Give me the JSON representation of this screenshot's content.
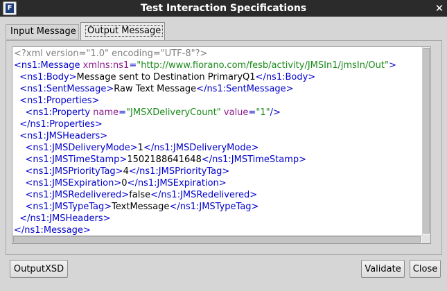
{
  "window": {
    "title": "Test Interaction Specifications",
    "app_icon_glyph": "F",
    "close_glyph": "✕"
  },
  "tabs": [
    {
      "label": "Input Message",
      "active": false
    },
    {
      "label": "Output Message",
      "active": true
    }
  ],
  "editor": {
    "lines": [
      [
        {
          "t": "decl",
          "v": "<?xml version=\"1.0\" encoding=\"UTF-8\"?>"
        }
      ],
      [
        {
          "t": "tag",
          "v": "<ns1:Message "
        },
        {
          "t": "attr",
          "v": "xmlns:ns1"
        },
        {
          "t": "tag",
          "v": "="
        },
        {
          "t": "val",
          "v": "\"http://www.fiorano.com/fesb/activity/JMSIn1/jmsIn/Out\""
        },
        {
          "t": "tag",
          "v": ">"
        }
      ],
      [
        {
          "t": "tag",
          "v": "  <ns1:Body>"
        },
        {
          "t": "text",
          "v": "Message sent to Destination PrimaryQ1"
        },
        {
          "t": "tag",
          "v": "</ns1:Body>"
        }
      ],
      [
        {
          "t": "tag",
          "v": "  <ns1:SentMessage>"
        },
        {
          "t": "text",
          "v": "Raw Text Message"
        },
        {
          "t": "tag",
          "v": "</ns1:SentMessage>"
        }
      ],
      [
        {
          "t": "tag",
          "v": "  <ns1:Properties>"
        }
      ],
      [
        {
          "t": "tag",
          "v": "    <ns1:Property "
        },
        {
          "t": "attr",
          "v": "name"
        },
        {
          "t": "tag",
          "v": "="
        },
        {
          "t": "val",
          "v": "\"JMSXDeliveryCount\""
        },
        {
          "t": "tag",
          "v": " "
        },
        {
          "t": "attr",
          "v": "value"
        },
        {
          "t": "tag",
          "v": "="
        },
        {
          "t": "val",
          "v": "\"1\""
        },
        {
          "t": "tag",
          "v": "/>"
        }
      ],
      [
        {
          "t": "tag",
          "v": "  </ns1:Properties>"
        }
      ],
      [
        {
          "t": "tag",
          "v": "  <ns1:JMSHeaders>"
        }
      ],
      [
        {
          "t": "tag",
          "v": "    <ns1:JMSDeliveryMode>"
        },
        {
          "t": "text",
          "v": "1"
        },
        {
          "t": "tag",
          "v": "</ns1:JMSDeliveryMode>"
        }
      ],
      [
        {
          "t": "tag",
          "v": "    <ns1:JMSTimeStamp>"
        },
        {
          "t": "text",
          "v": "1502188641648"
        },
        {
          "t": "tag",
          "v": "</ns1:JMSTimeStamp>"
        }
      ],
      [
        {
          "t": "tag",
          "v": "    <ns1:JMSPriorityTag>"
        },
        {
          "t": "text",
          "v": "4"
        },
        {
          "t": "tag",
          "v": "</ns1:JMSPriorityTag>"
        }
      ],
      [
        {
          "t": "tag",
          "v": "    <ns1:JMSExpiration>"
        },
        {
          "t": "text",
          "v": "0"
        },
        {
          "t": "tag",
          "v": "</ns1:JMSExpiration>"
        }
      ],
      [
        {
          "t": "tag",
          "v": "    <ns1:JMSRedelivered>"
        },
        {
          "t": "text",
          "v": "false"
        },
        {
          "t": "tag",
          "v": "</ns1:JMSRedelivered>"
        }
      ],
      [
        {
          "t": "tag",
          "v": "    <ns1:JMSTypeTag>"
        },
        {
          "t": "text",
          "v": "TextMessage"
        },
        {
          "t": "tag",
          "v": "</ns1:JMSTypeTag>"
        }
      ],
      [
        {
          "t": "tag",
          "v": "  </ns1:JMSHeaders>"
        }
      ],
      [
        {
          "t": "tag",
          "v": "</ns1:Message>"
        }
      ]
    ]
  },
  "buttons": {
    "output_xsd": "OutputXSD",
    "validate": "Validate",
    "close": "Close"
  },
  "colors": {
    "tag": "#0000cc",
    "attr": "#8b1c8b",
    "value": "#1a8a1a",
    "decl": "#7f7f7f",
    "titlebar": "#2b2b2b"
  }
}
